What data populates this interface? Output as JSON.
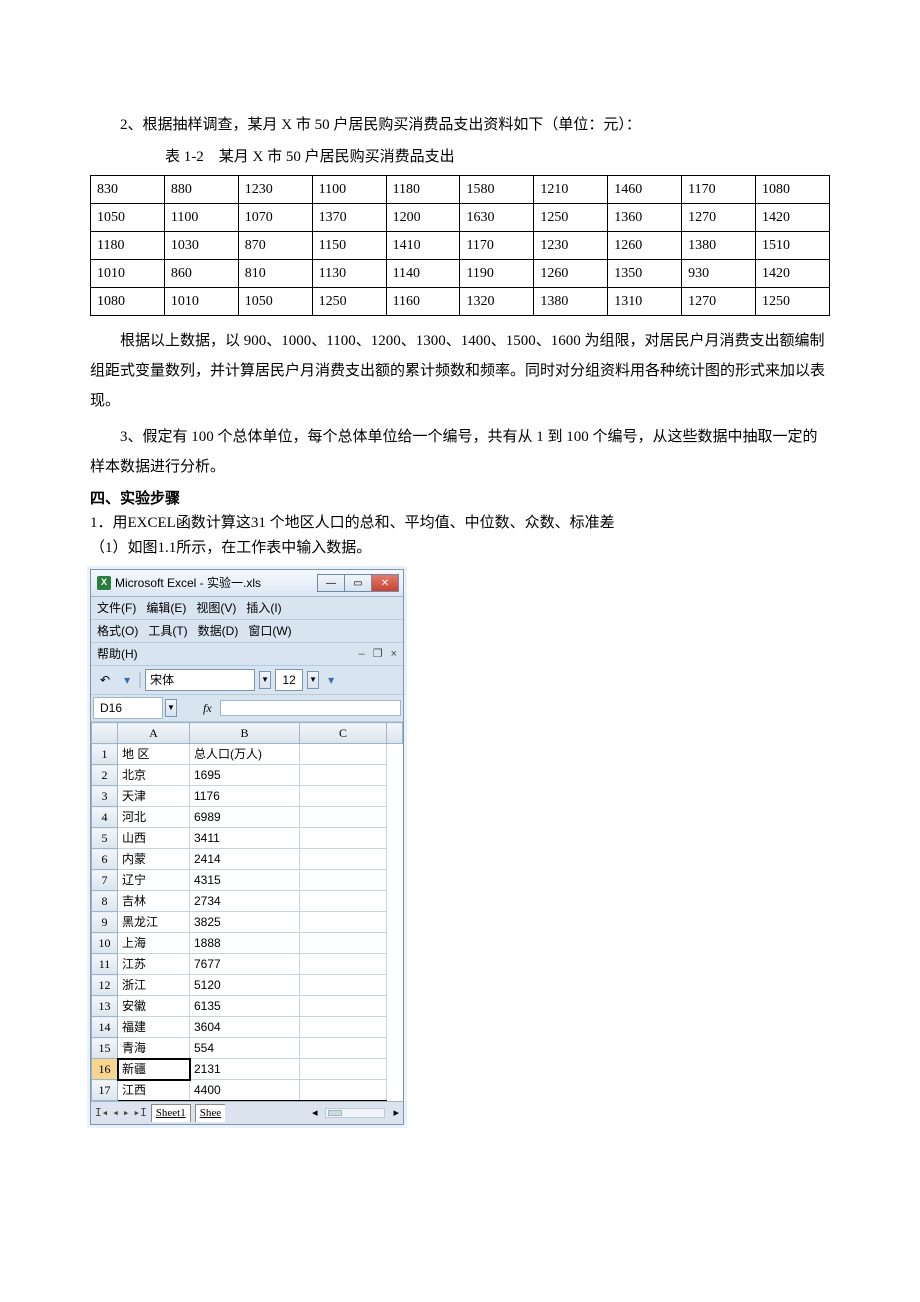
{
  "q2_intro": "2、根据抽样调查，某月 X 市 50 户居民购买消费品支出资料如下（单位：元）：",
  "table_caption": "表 1-2　某月 X 市 50 户居民购买消费品支出",
  "table_rows": [
    [
      "830",
      "880",
      "1230",
      "1100",
      "1180",
      "1580",
      "1210",
      "1460",
      "1170",
      "1080"
    ],
    [
      "1050",
      "1100",
      "1070",
      "1370",
      "1200",
      "1630",
      "1250",
      "1360",
      "1270",
      "1420"
    ],
    [
      "1180",
      "1030",
      "870",
      "1150",
      "1410",
      "1170",
      "1230",
      "1260",
      "1380",
      "1510"
    ],
    [
      "1010",
      "860",
      "810",
      "1130",
      "1140",
      "1190",
      "1260",
      "1350",
      "930",
      "1420"
    ],
    [
      "1080",
      "1010",
      "1050",
      "1250",
      "1160",
      "1320",
      "1380",
      "1310",
      "1270",
      "1250"
    ]
  ],
  "q2_desc": "根据以上数据，以 900、1000、1100、1200、1300、1400、1500、1600 为组限，对居民户月消费支出额编制组距式变量数列，并计算居民户月消费支出额的累计频数和频率。同时对分组资料用各种统计图的形式来加以表现。",
  "q3": "3、假定有 100 个总体单位，每个总体单位给一个编号，共有从 1 到 100 个编号，从这些数据中抽取一定的样本数据进行分析。",
  "sec4_heading": "四、实验步骤",
  "step1": "1．用EXCEL函数计算这31 个地区人口的总和、平均值、中位数、众数、标准差",
  "step1_1": "（1）如图1.1所示，在工作表中输入数据。",
  "excel": {
    "app_title": "Microsoft Excel - 实验一.xls",
    "menus": {
      "file": "文件(F)",
      "edit": "编辑(E)",
      "view": "视图(V)",
      "insert": "插入(I)",
      "format": "格式(O)",
      "tools": "工具(T)",
      "data": "数据(D)",
      "window": "窗口(W)",
      "help": "帮助(H)"
    },
    "font_name": "宋体",
    "font_size": "12",
    "namebox": "D16",
    "fx_label": "fx",
    "col_headers": [
      "A",
      "B",
      "C"
    ],
    "rows": [
      {
        "n": "1",
        "a": "地 区",
        "b": "总人口(万人)"
      },
      {
        "n": "2",
        "a": "北京",
        "b": "1695"
      },
      {
        "n": "3",
        "a": "天津",
        "b": "1176"
      },
      {
        "n": "4",
        "a": "河北",
        "b": "6989"
      },
      {
        "n": "5",
        "a": "山西",
        "b": "3411"
      },
      {
        "n": "6",
        "a": "内蒙",
        "b": "2414"
      },
      {
        "n": "7",
        "a": "辽宁",
        "b": "4315"
      },
      {
        "n": "8",
        "a": "吉林",
        "b": "2734"
      },
      {
        "n": "9",
        "a": "黑龙江",
        "b": "3825"
      },
      {
        "n": "10",
        "a": "上海",
        "b": "1888"
      },
      {
        "n": "11",
        "a": "江苏",
        "b": "7677"
      },
      {
        "n": "12",
        "a": "浙江",
        "b": "5120"
      },
      {
        "n": "13",
        "a": "安徽",
        "b": "6135"
      },
      {
        "n": "14",
        "a": "福建",
        "b": "3604"
      },
      {
        "n": "15",
        "a": "青海",
        "b": "554"
      },
      {
        "n": "16",
        "a": "新疆",
        "b": "2131"
      },
      {
        "n": "17",
        "a": "江西",
        "b": "4400"
      }
    ],
    "sheet_tab1": "Sheet1",
    "sheet_tab2": "Shee"
  },
  "chart_data": {
    "type": "table",
    "title": "某月 X 市 50 户居民购买消费品支出（单位：元）",
    "values": [
      [
        830,
        880,
        1230,
        1100,
        1180,
        1580,
        1210,
        1460,
        1170,
        1080
      ],
      [
        1050,
        1100,
        1070,
        1370,
        1200,
        1630,
        1250,
        1360,
        1270,
        1420
      ],
      [
        1180,
        1030,
        870,
        1150,
        1410,
        1170,
        1230,
        1260,
        1380,
        1510
      ],
      [
        1010,
        860,
        810,
        1130,
        1140,
        1190,
        1260,
        1350,
        930,
        1420
      ],
      [
        1080,
        1010,
        1050,
        1250,
        1160,
        1320,
        1380,
        1310,
        1270,
        1250
      ]
    ]
  }
}
